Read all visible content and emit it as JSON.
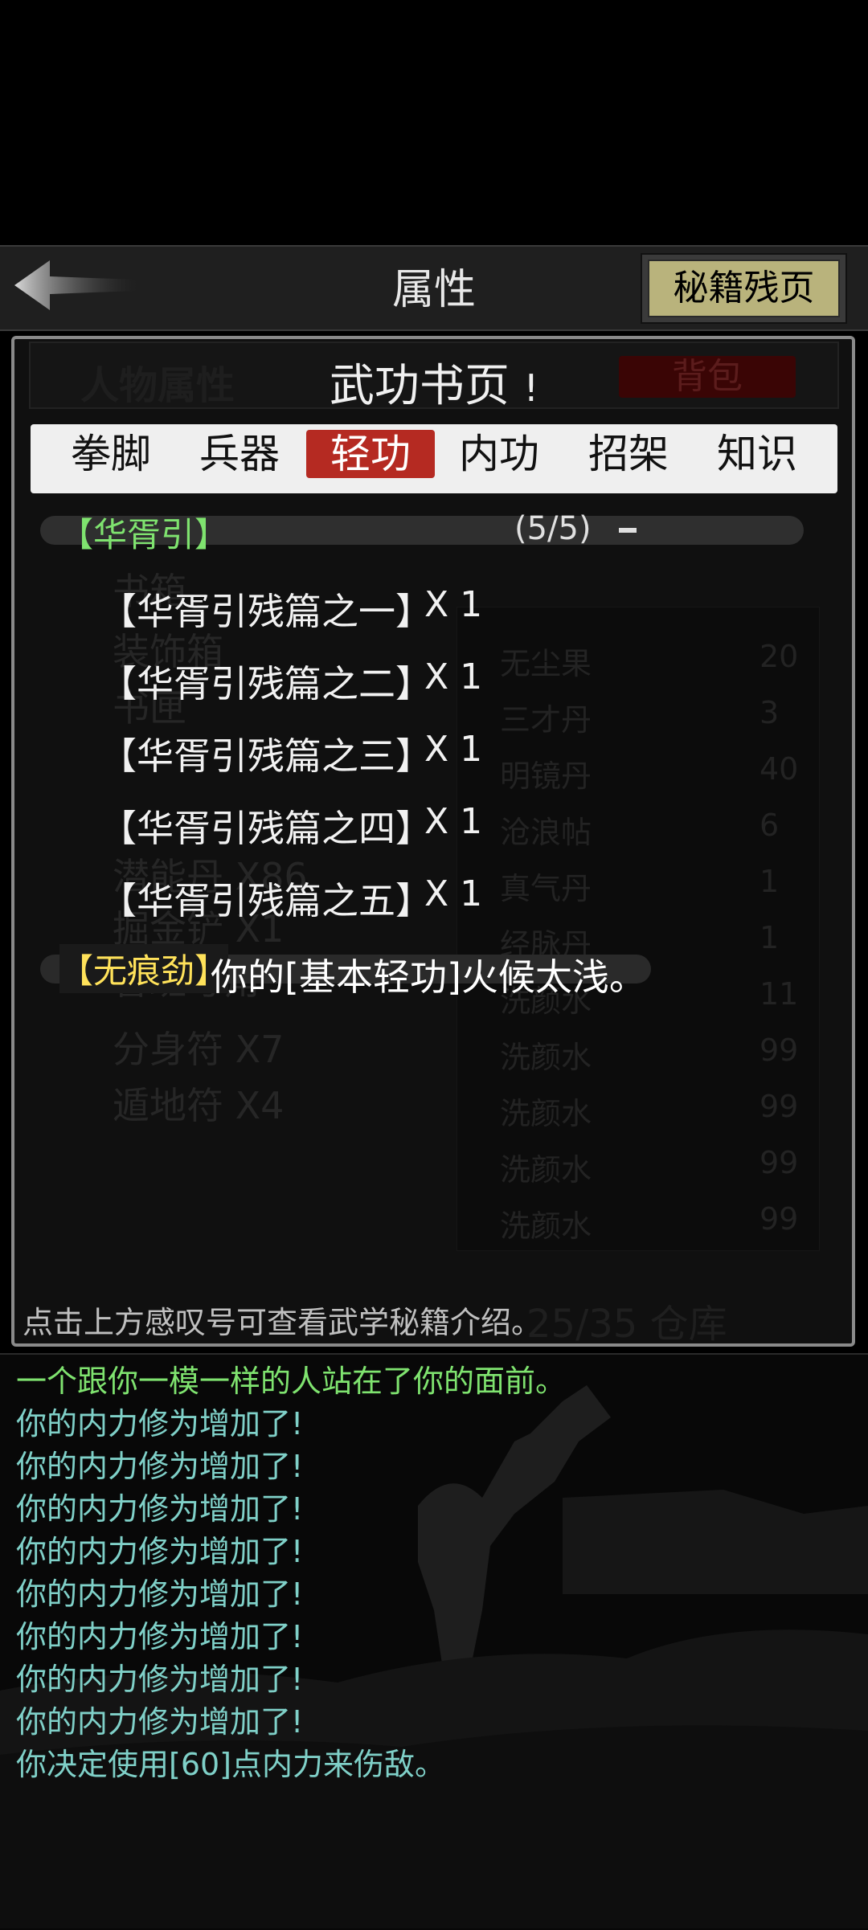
{
  "header": {
    "title": "属性",
    "right_button": "秘籍残页"
  },
  "panel": {
    "ghost_tab_left": "人物属性",
    "ghost_tab_right": "背包",
    "page_title": "武功书页",
    "page_title_mark": "!"
  },
  "tabs": [
    {
      "label": "拳脚",
      "active": false
    },
    {
      "label": "兵器",
      "active": false
    },
    {
      "label": "轻功",
      "active": true
    },
    {
      "label": "内功",
      "active": false
    },
    {
      "label": "招架",
      "active": false
    },
    {
      "label": "知识",
      "active": false
    }
  ],
  "ghost_left": [
    "书箱",
    "装饰箱",
    "书匣",
    "潜能丹 X86",
    "掘金铲 X1",
    "鲁班号角",
    "分身符 X7",
    "遁地符 X4"
  ],
  "ghost_right": [
    {
      "name": "无尘果",
      "qty": "20"
    },
    {
      "name": "三才丹",
      "qty": "3"
    },
    {
      "name": "明镜丹",
      "qty": "40"
    },
    {
      "name": "沧浪帖",
      "qty": "6"
    },
    {
      "name": "真气丹",
      "qty": "1"
    },
    {
      "name": "经脉丹",
      "qty": "1"
    },
    {
      "name": "洗颜水",
      "qty": "11"
    },
    {
      "name": "洗颜水",
      "qty": "99"
    },
    {
      "name": "洗颜水",
      "qty": "99"
    },
    {
      "name": "洗颜水",
      "qty": "99"
    },
    {
      "name": "洗颜水",
      "qty": "99"
    }
  ],
  "group": {
    "name": "【华胥引】",
    "count": "(5/5)"
  },
  "items": [
    {
      "name": "【华胥引残篇之一】",
      "qty": "X 1"
    },
    {
      "name": "【华胥引残篇之二】",
      "qty": "X 1"
    },
    {
      "name": "【华胥引残篇之三】",
      "qty": "X 1"
    },
    {
      "name": "【华胥引残篇之四】",
      "qty": "X 1"
    },
    {
      "name": "【华胥引残篇之五】",
      "qty": "X 1"
    }
  ],
  "group2": {
    "name": "【无痕劲】",
    "message": "你的[基本轻功]火候太浅。"
  },
  "hint": "点击上方感叹号可查看武学秘籍介绍。",
  "ghost_storage": "25/35 仓库",
  "log": [
    {
      "text": "一个跟你一模一样的人站在了你的面前。",
      "color": "#7fe36f"
    },
    {
      "text": "你的内力修为增加了!",
      "color": "#7fd0c8"
    },
    {
      "text": "你的内力修为增加了!",
      "color": "#7fd0c8"
    },
    {
      "text": "你的内力修为增加了!",
      "color": "#7fd0c8"
    },
    {
      "text": "你的内力修为增加了!",
      "color": "#7fd0c8"
    },
    {
      "text": "你的内力修为增加了!",
      "color": "#7fd0c8"
    },
    {
      "text": "你的内力修为增加了!",
      "color": "#7fd0c8"
    },
    {
      "text": "你的内力修为增加了!",
      "color": "#7fd0c8"
    },
    {
      "text": "你的内力修为增加了!",
      "color": "#7fd0c8"
    },
    {
      "text": "你决定使用[60]点内力来伤敌。",
      "color": "#7fd0c8"
    }
  ]
}
